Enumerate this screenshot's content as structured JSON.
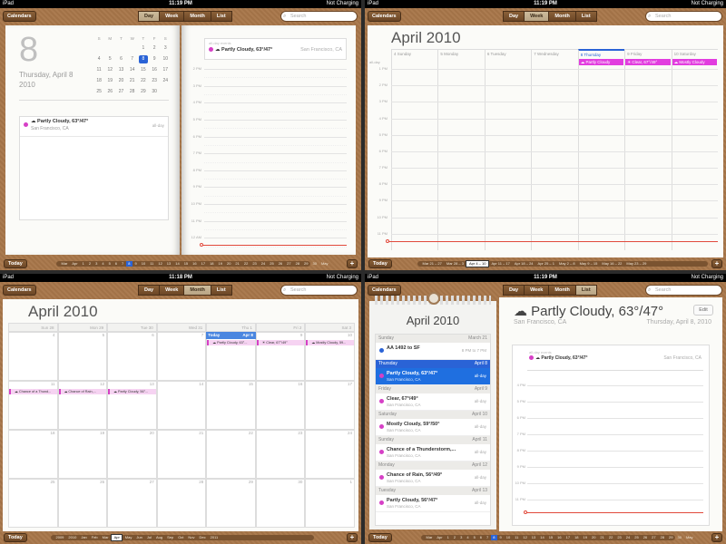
{
  "status": {
    "device": "iPad",
    "battery": "Not Charging",
    "time1": "11:19 PM",
    "time2": "11:19 PM",
    "time3": "11:18 PM",
    "time4": "11:19 PM"
  },
  "toolbar": {
    "calendars": "Calendars",
    "day": "Day",
    "week": "Week",
    "month": "Month",
    "list": "List",
    "search_placeholder": "Search",
    "today": "Today",
    "add": "+"
  },
  "day_view": {
    "big_date": "8",
    "weekday_date": "Thursday, April 8",
    "year": "2010",
    "mini_weekdays": [
      "S",
      "M",
      "T",
      "W",
      "T",
      "F",
      "S"
    ],
    "mini_rows": [
      [
        "",
        "",
        "",
        "",
        "1",
        "2",
        "3"
      ],
      [
        "4",
        "5",
        "6",
        "7",
        "8",
        "9",
        "10"
      ],
      [
        "11",
        "12",
        "13",
        "14",
        "15",
        "16",
        "17"
      ],
      [
        "18",
        "19",
        "20",
        "21",
        "22",
        "23",
        "24"
      ],
      [
        "25",
        "26",
        "27",
        "28",
        "29",
        "30",
        ""
      ]
    ],
    "event_title": "Partly Cloudy, 63°/47°",
    "event_location": "San Francisco, CA",
    "all_day": "all-day",
    "all_day_events": "all-day events",
    "hours": [
      "2 PM",
      "3 PM",
      "4 PM",
      "5 PM",
      "6 PM",
      "7 PM",
      "8 PM",
      "9 PM",
      "10 PM",
      "11 PM",
      "12 AM"
    ]
  },
  "day_timeline": [
    "Mar",
    "Apr",
    "1",
    "2",
    "3",
    "4",
    "5",
    "6",
    "7",
    "8",
    "9",
    "10",
    "11",
    "12",
    "13",
    "14",
    "15",
    "16",
    "17",
    "18",
    "19",
    "20",
    "21",
    "22",
    "23",
    "24",
    "25",
    "26",
    "27",
    "28",
    "29",
    "30",
    "May"
  ],
  "week_view": {
    "title": "April 2010",
    "allday": "all-day",
    "days": [
      "4 Sunday",
      "5 Monday",
      "6 Tuesday",
      "7 Wednesday",
      "8 Thursday",
      "9 Friday",
      "10 Saturday"
    ],
    "events": [
      "Partly Cloudy",
      "Clear, 67°/49°",
      "Mostly Cloudy"
    ],
    "hours": [
      "1 PM",
      "2 PM",
      "3 PM",
      "4 PM",
      "5 PM",
      "6 PM",
      "7 PM",
      "8 PM",
      "9 PM",
      "10 PM",
      "11 PM"
    ]
  },
  "week_timeline": [
    "Mar 21 – 27",
    "Mar 28 – 3",
    "Apr 4 – 10",
    "Apr 11 – 17",
    "Apr 18 – 24",
    "Apr 25 – 1",
    "May 2 – 8",
    "May 9 – 15",
    "May 16 – 22",
    "May 23 – 29"
  ],
  "month_view": {
    "title": "April 2010",
    "headers": [
      "Sun 28",
      "Mon 29",
      "Tue 30",
      "Wed 31",
      "Thu 1",
      "Fri 2",
      "Sat 3"
    ],
    "rows": [
      [
        "4",
        "5",
        "6",
        "7",
        "8",
        "9",
        "10"
      ],
      [
        "11",
        "12",
        "13",
        "14",
        "15",
        "16",
        "17"
      ],
      [
        "18",
        "19",
        "20",
        "21",
        "22",
        "23",
        "24"
      ],
      [
        "25",
        "26",
        "27",
        "28",
        "29",
        "30",
        "1"
      ]
    ],
    "today": "Today",
    "today_date": "Apr 8",
    "events_r1": [
      "Partly Cloudy, 63°...",
      "Clear, 67°/49°",
      "Mostly Cloudy, 59..."
    ],
    "events_r2": [
      "Chance of a Thund...",
      "Chance of Rain,...",
      "Partly Cloudy, 56°..."
    ]
  },
  "month_timeline": [
    "2009",
    "2010",
    "Jan",
    "Feb",
    "Mar",
    "Apr",
    "May",
    "Jun",
    "Jul",
    "Aug",
    "Sep",
    "Oct",
    "Nov",
    "Dec",
    "2011"
  ],
  "list_view": {
    "title": "April 2010",
    "sections": [
      {
        "day": "Sunday",
        "date": "March 21",
        "items": [
          {
            "title": "AA 1492 to SF",
            "time": "8 PM to 7 PM",
            "color": "#2a63d6"
          }
        ]
      },
      {
        "day": "Thursday",
        "date": "April 8",
        "selected": true,
        "items": [
          {
            "title": "Partly Cloudy, 63°/47°",
            "sub": "San Francisco, CA",
            "time": "all-day"
          }
        ]
      },
      {
        "day": "Friday",
        "date": "April 9",
        "items": [
          {
            "title": "Clear, 67°/49°",
            "sub": "San Francisco, CA",
            "time": "all-day"
          }
        ]
      },
      {
        "day": "Saturday",
        "date": "April 10",
        "items": [
          {
            "title": "Mostly Cloudy, 59°/50°",
            "sub": "San Francisco, CA",
            "time": "all-day"
          }
        ]
      },
      {
        "day": "Sunday",
        "date": "April 11",
        "items": [
          {
            "title": "Chance of a Thunderstorm,...",
            "sub": "San Francisco, CA",
            "time": "all-day"
          }
        ]
      },
      {
        "day": "Monday",
        "date": "April 12",
        "items": [
          {
            "title": "Chance of Rain, 56°/49°",
            "sub": "San Francisco, CA",
            "time": "all-day"
          }
        ]
      },
      {
        "day": "Tuesday",
        "date": "April 13",
        "items": [
          {
            "title": "Partly Cloudy, 56°/47°",
            "sub": "San Francisco, CA",
            "time": "all-day"
          }
        ]
      }
    ],
    "detail_title": "Partly Cloudy, 63°/47°",
    "detail_location": "San Francisco, CA",
    "detail_date": "Thursday, April 8, 2010",
    "edit": "Edit",
    "all_day_events": "all-day events",
    "hours": [
      "4 PM",
      "5 PM",
      "6 PM",
      "7 PM",
      "8 PM",
      "9 PM",
      "10 PM",
      "11 PM"
    ]
  },
  "list_timeline": [
    "Mar",
    "Apr",
    "1",
    "2",
    "3",
    "4",
    "5",
    "6",
    "7",
    "8",
    "9",
    "10",
    "11",
    "12",
    "13",
    "14",
    "15",
    "16",
    "17",
    "18",
    "19",
    "20",
    "21",
    "22",
    "23",
    "24",
    "25",
    "26",
    "27",
    "28",
    "29",
    "30",
    "May"
  ]
}
